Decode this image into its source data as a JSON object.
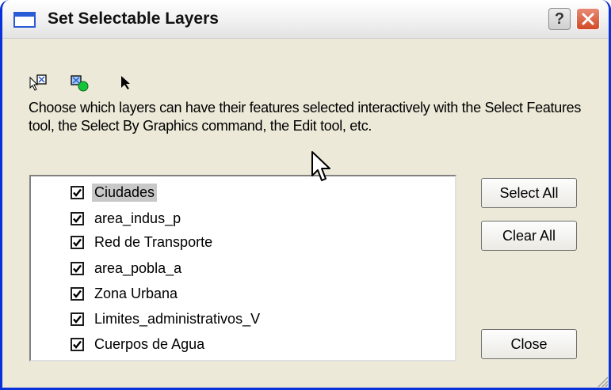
{
  "window": {
    "title": "Set Selectable Layers",
    "help_label": "?",
    "close_label": "✕"
  },
  "toolbar": {
    "icons": [
      "select-features-icon",
      "select-by-graphics-icon",
      "select-elements-arrow-icon"
    ]
  },
  "description": "Choose which layers can have their features selected interactively with the Select Features tool, the Select By Graphics command, the Edit tool, etc.",
  "layers": [
    {
      "label": "Ciudades",
      "checked": true,
      "selected": true
    },
    {
      "label": "area_indus_p",
      "checked": true,
      "selected": false
    },
    {
      "label": "Red de Transporte",
      "checked": true,
      "selected": false
    },
    {
      "label": "area_pobla_a",
      "checked": true,
      "selected": false
    },
    {
      "label": "Zona Urbana",
      "checked": true,
      "selected": false
    },
    {
      "label": "Limites_administrativos_V",
      "checked": true,
      "selected": false
    },
    {
      "label": "Cuerpos de Agua",
      "checked": true,
      "selected": false
    }
  ],
  "buttons": {
    "select_all": "Select All",
    "clear_all": "Clear All",
    "close": "Close"
  },
  "colors": {
    "title_frame": "#0831d9",
    "dialog_bg": "#ece9d8",
    "close_button": "#d14a27",
    "selection_highlight": "#c8c8c8"
  }
}
